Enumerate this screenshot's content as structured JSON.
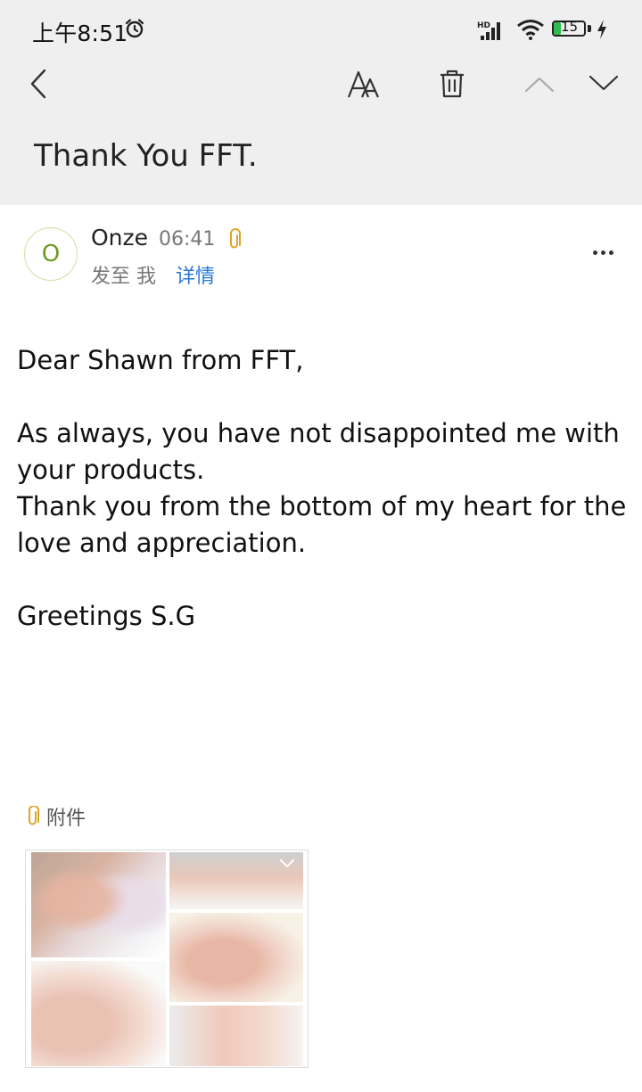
{
  "status_bar": {
    "time": "上午8:51",
    "network": "HD",
    "battery": "15"
  },
  "toolbar": {
    "back_icon": "chevron-left-icon",
    "font_icon": "font-size-icon",
    "delete_icon": "trash-icon",
    "prev_icon": "chevron-up-icon",
    "next_icon": "chevron-down-icon"
  },
  "email": {
    "subject": "Thank You FFT.",
    "sender": {
      "avatar_letter": "O",
      "name": "Onze",
      "time": "06:41",
      "to_label": "发至 我",
      "details_link": "详情"
    },
    "body": {
      "greeting": "Dear Shawn from FFT,",
      "paragraph1": "As always, you have not disappointed me with your products.",
      "paragraph2": "Thank you from the bottom of my heart for the love and appreciation.",
      "closing": "Greetings S.G"
    },
    "attachments": {
      "label": "附件"
    }
  },
  "colors": {
    "accent_link": "#2a78d6",
    "attachment_clip": "#e0a526",
    "avatar": "#6f9b22",
    "header_bg": "#efeff0"
  }
}
